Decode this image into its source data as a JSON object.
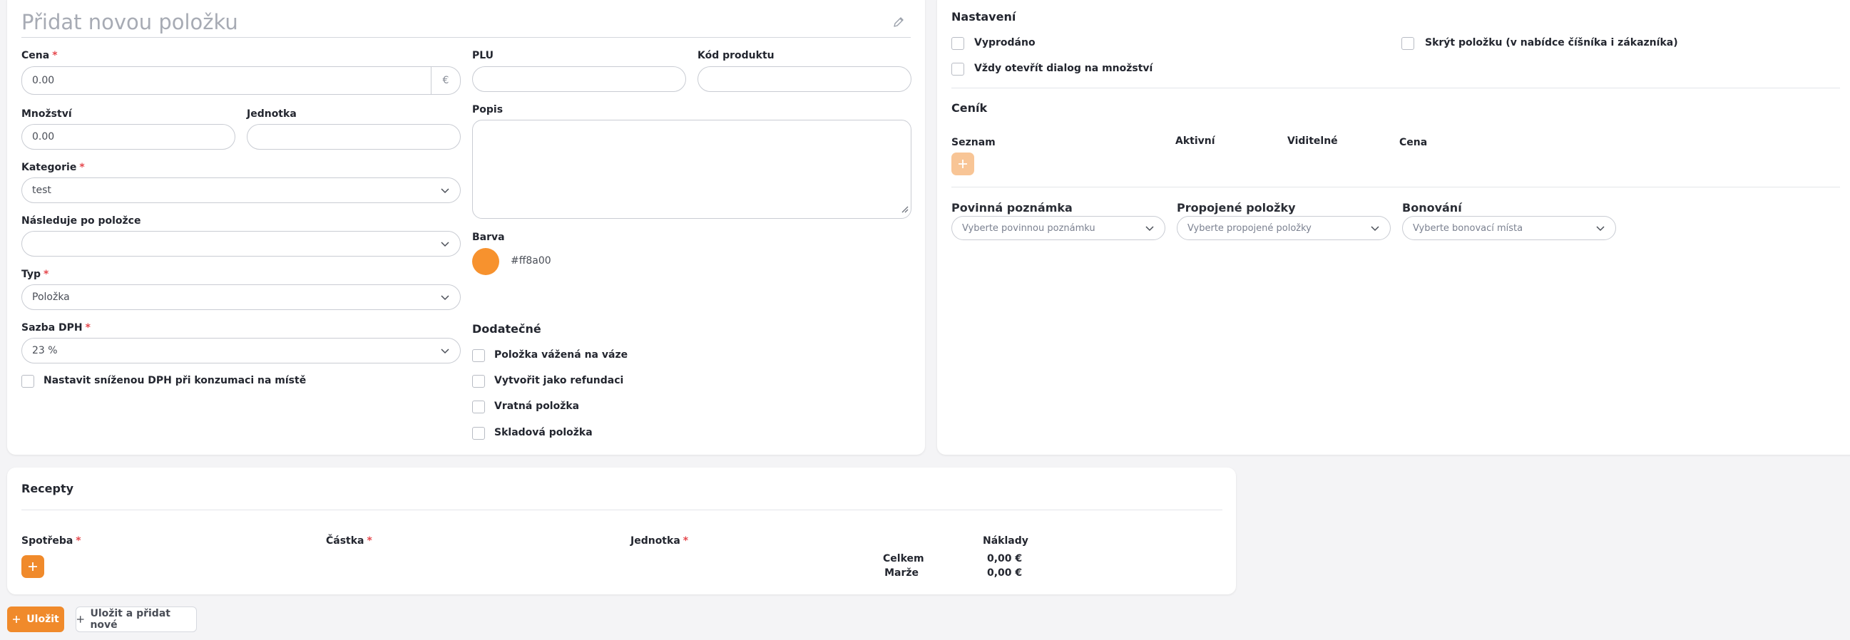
{
  "main_form": {
    "title": "Přidat novou položku",
    "price_label": "Cena",
    "price_value": "0.00",
    "currency_symbol": "€",
    "plu_label": "PLU",
    "plu_value": "",
    "product_code_label": "Kód produktu",
    "product_code_value": "",
    "quantity_label": "Množství",
    "quantity_value": "0.00",
    "unit_label": "Jednotka",
    "unit_value": "",
    "description_label": "Popis",
    "description_value": "",
    "category_label": "Kategorie",
    "category_value": "test",
    "follows_label": "Následuje po položce",
    "follows_value": "",
    "color_label": "Barva",
    "color_value": "#ff8a00",
    "type_label": "Typ",
    "type_value": "Položka",
    "vat_label": "Sazba DPH",
    "vat_value": "23 %",
    "reduced_vat_label": "Nastavit sníženou DPH při konzumaci na místě",
    "additional_heading": "Dodatečné",
    "additional_options": [
      "Položka vážená na váze",
      "Vytvořit jako refundaci",
      "Vratná položka",
      "Skladová položka"
    ]
  },
  "settings": {
    "heading": "Nastavení",
    "sold_out_label": "Vyprodáno",
    "hide_item_label": "Skrýt položku (v nabídce číšníka i zákazníka)",
    "always_qty_dialog_label": "Vždy otevřít dialog na množství",
    "pricelist_heading": "Ceník",
    "pricelist_columns": [
      "Seznam",
      "Aktivní",
      "Viditelné",
      "Cena"
    ],
    "mandatory_note_label": "Povinná poznámka",
    "mandatory_note_placeholder": "Vyberte povinnou poznámku",
    "linked_items_label": "Propojené položky",
    "linked_items_placeholder": "Vyberte propojené položky",
    "bonus_label": "Bonování",
    "bonus_placeholder": "Vyberte bonovací místa"
  },
  "recipes": {
    "heading": "Recepty",
    "consumption_label": "Spotřeba",
    "amount_label": "Částka",
    "unit_label": "Jednotka",
    "costs_label": "Náklady",
    "total_label": "Celkem",
    "total_value": "0,00 €",
    "margin_label": "Marže",
    "margin_value": "0,00 €"
  },
  "actions": {
    "save_label": "Uložit",
    "save_and_new_label": "Uložit a přidat nové"
  },
  "colors": {
    "accent": "#f08a2b",
    "required": "#e5484d",
    "item_color": "#f7922e"
  }
}
